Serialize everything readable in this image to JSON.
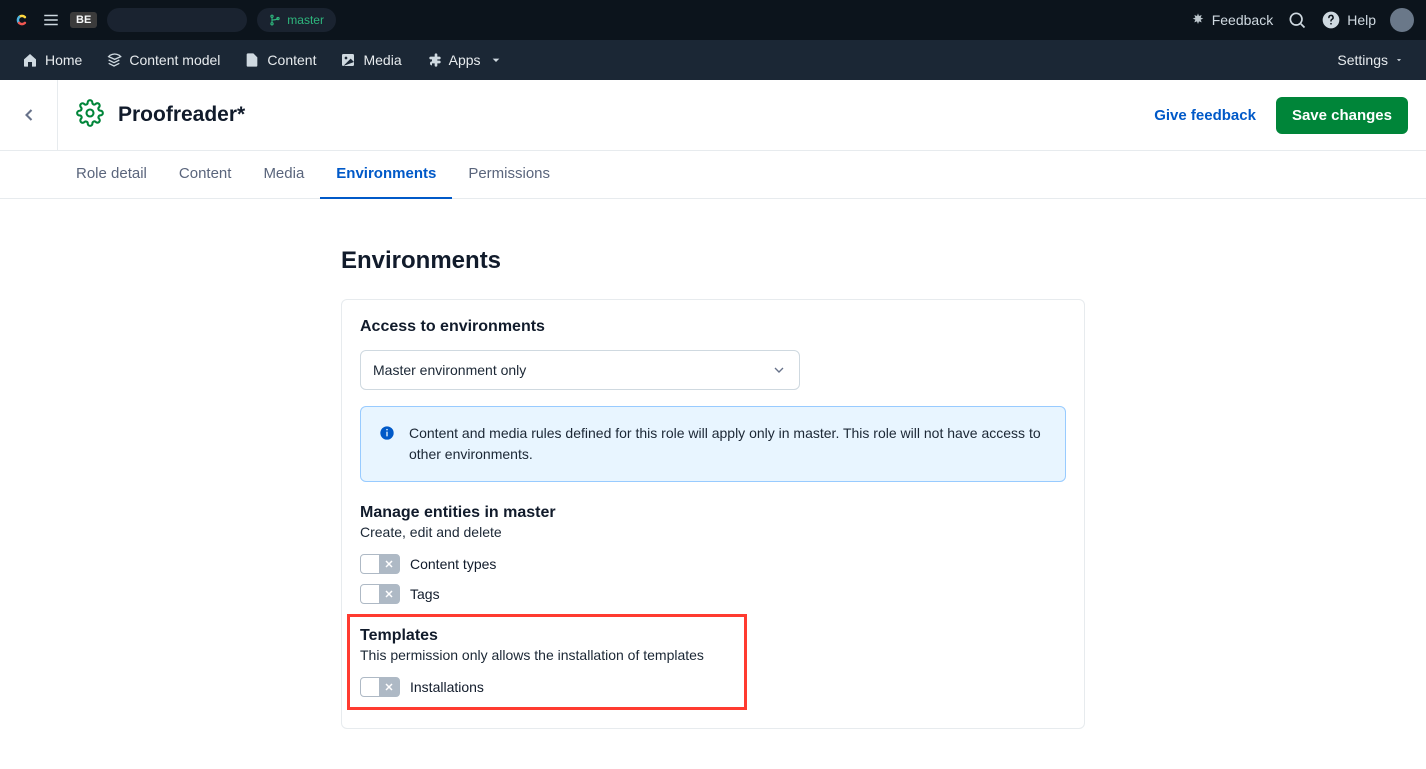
{
  "topbar": {
    "badge": "BE",
    "branch": "master",
    "feedback": "Feedback",
    "help": "Help"
  },
  "nav": {
    "home": "Home",
    "content_model": "Content model",
    "content": "Content",
    "media": "Media",
    "apps": "Apps",
    "settings": "Settings"
  },
  "header": {
    "title": "Proofreader*",
    "give_feedback": "Give feedback",
    "save": "Save changes"
  },
  "tabs": {
    "role_detail": "Role detail",
    "content": "Content",
    "media": "Media",
    "environments": "Environments",
    "permissions": "Permissions"
  },
  "env": {
    "heading": "Environments",
    "access_head": "Access to environments",
    "select_value": "Master environment only",
    "info_text": "Content and media rules defined for this role will apply only in master. This role will not have access to other environments.",
    "manage_head": "Manage entities in master",
    "manage_desc": "Create, edit and delete",
    "toggle_content_types": "Content types",
    "toggle_tags": "Tags",
    "templates_head": "Templates",
    "templates_desc": "This permission only allows the installation of templates",
    "toggle_installations": "Installations"
  }
}
